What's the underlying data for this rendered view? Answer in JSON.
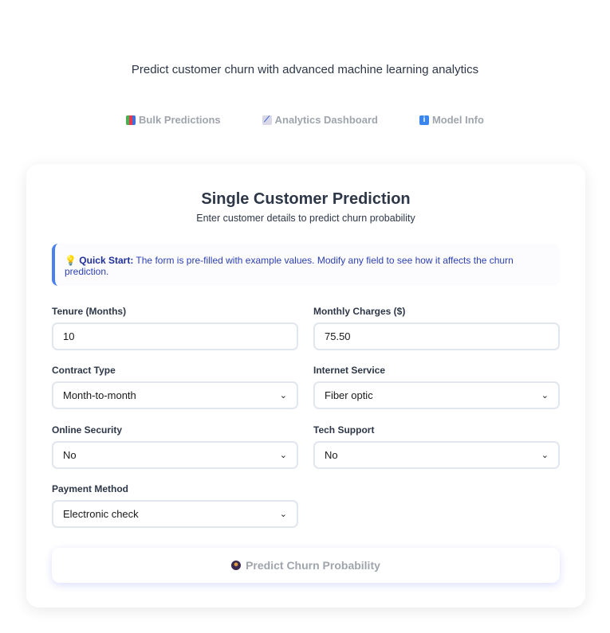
{
  "header": {
    "subtitle": "Predict customer churn with advanced machine learning analytics"
  },
  "nav": [
    {
      "icon": "bar-chart-icon",
      "label": "Bulk Predictions"
    },
    {
      "icon": "line-chart-icon",
      "label": "Analytics Dashboard"
    },
    {
      "icon": "info-icon",
      "label": "Model Info"
    }
  ],
  "card": {
    "title": "Single Customer Prediction",
    "description": "Enter customer details to predict churn probability"
  },
  "info": {
    "bold": "Quick Start:",
    "text": " The form is pre-filled with example values. Modify any field to see how it affects the churn prediction."
  },
  "fields": [
    {
      "label": "Tenure (Months)",
      "value": "10"
    },
    {
      "label": "Monthly Charges ($)",
      "value": "75.50"
    },
    {
      "label": "Contract Type",
      "value": "Month-to-month"
    },
    {
      "label": "Internet Service",
      "value": "Fiber optic"
    },
    {
      "label": "Online Security",
      "value": "No"
    },
    {
      "label": "Tech Support",
      "value": "No"
    },
    {
      "label": "Payment Method",
      "value": "Electronic check"
    }
  ],
  "predict_button": "Predict Churn Probability"
}
